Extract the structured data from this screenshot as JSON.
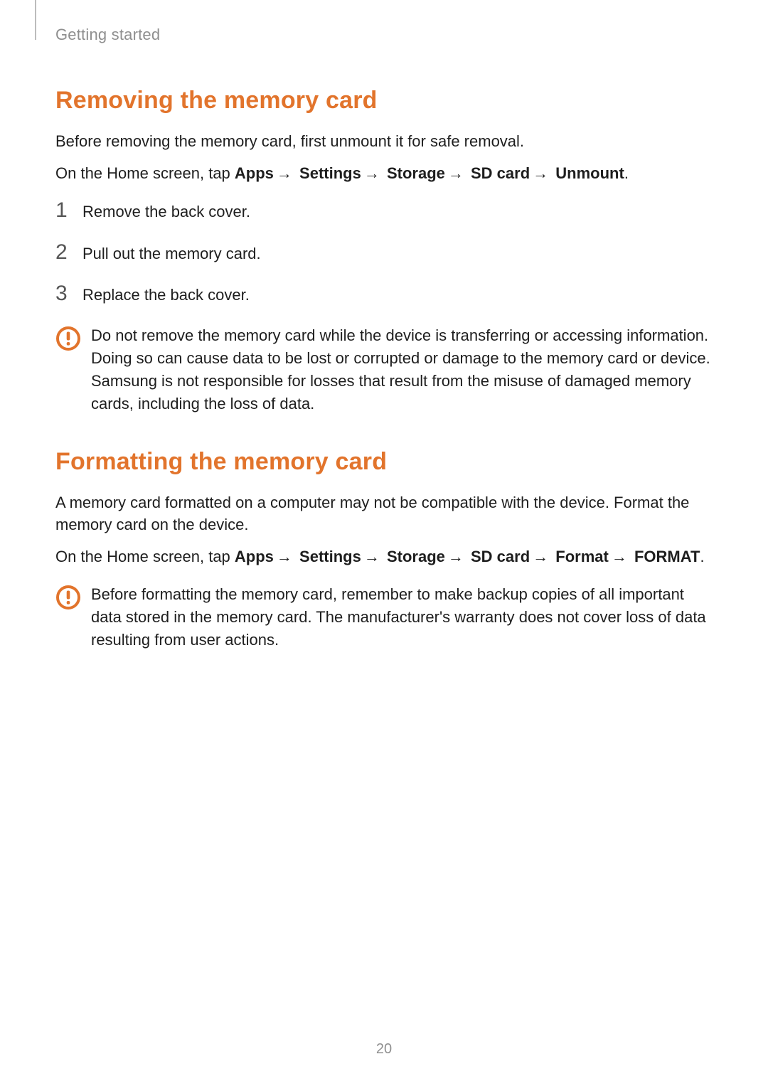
{
  "header": {
    "section_label": "Getting started"
  },
  "section_removing": {
    "title": "Removing the memory card",
    "intro": "Before removing the memory card, first unmount it for safe removal.",
    "onhome_prefix": "On the Home screen, tap ",
    "path": [
      "Apps",
      "Settings",
      "Storage",
      "SD card",
      "Unmount"
    ],
    "path_suffix": ".",
    "steps": [
      {
        "num": "1",
        "text": "Remove the back cover."
      },
      {
        "num": "2",
        "text": "Pull out the memory card."
      },
      {
        "num": "3",
        "text": "Replace the back cover."
      }
    ],
    "warning": "Do not remove the memory card while the device is transferring or accessing information. Doing so can cause data to be lost or corrupted or damage to the memory card or device. Samsung is not responsible for losses that result from the misuse of damaged memory cards, including the loss of data."
  },
  "section_formatting": {
    "title": "Formatting the memory card",
    "intro": "A memory card formatted on a computer may not be compatible with the device. Format the memory card on the device.",
    "onhome_prefix": "On the Home screen, tap ",
    "path": [
      "Apps",
      "Settings",
      "Storage",
      "SD card",
      "Format",
      "FORMAT"
    ],
    "path_suffix": ".",
    "warning": "Before formatting the memory card, remember to make backup copies of all important data stored in the memory card. The manufacturer's warranty does not cover loss of data resulting from user actions."
  },
  "page_number": "20",
  "glyphs": {
    "arrow": "→"
  }
}
